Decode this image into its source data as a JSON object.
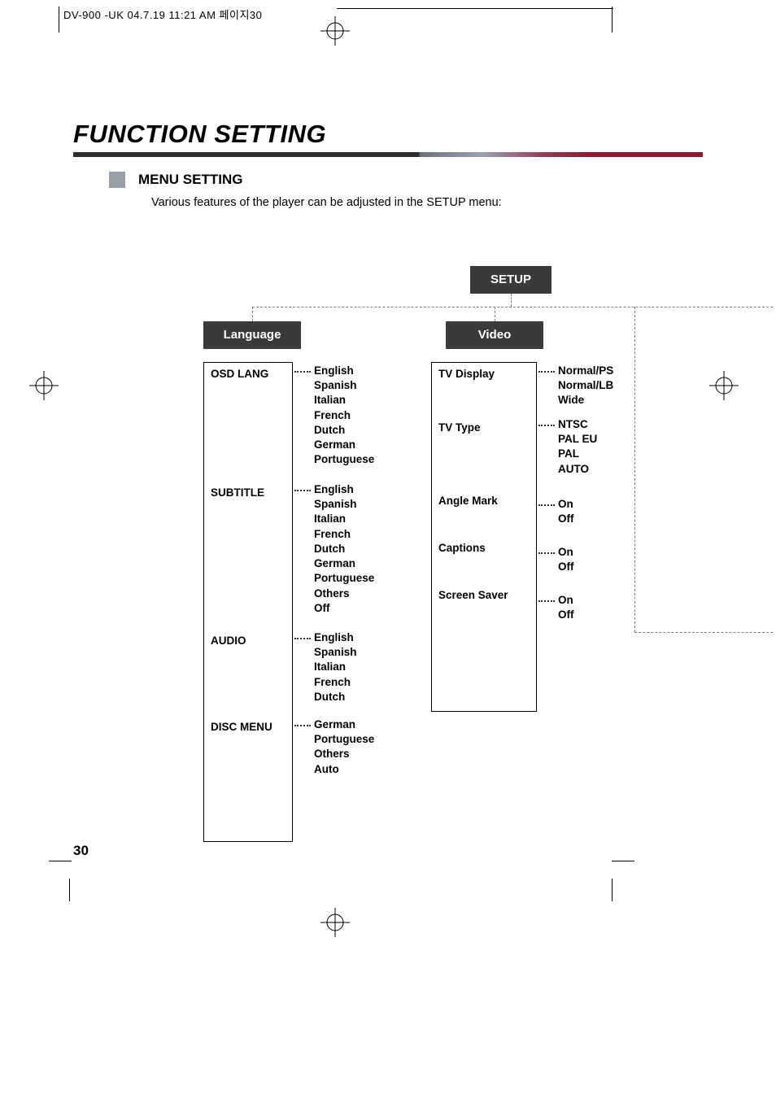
{
  "crop_header": "DV-900 -UK  04.7.19 11:21 AM  페이지30",
  "page_title": "FUNCTION SETTING",
  "menu_section_label": "MENU SETTING",
  "intro_text": "Various features of the player can be adjusted in the SETUP menu:",
  "page_number": "30",
  "setup": {
    "root_label": "SETUP",
    "language": {
      "label": "Language",
      "items": {
        "osd_lang": {
          "label": "OSD LANG",
          "options": [
            "English",
            "Spanish",
            "Italian",
            "French",
            "Dutch",
            "German",
            "Portuguese"
          ]
        },
        "subtitle": {
          "label": "SUBTITLE",
          "options": [
            "English",
            "Spanish",
            "Italian",
            "French",
            "Dutch",
            "German",
            "Portuguese",
            "Others",
            "Off"
          ]
        },
        "audio": {
          "label": "AUDIO",
          "options": [
            "English",
            "Spanish",
            "Italian",
            "French",
            "Dutch"
          ]
        },
        "disc_menu": {
          "label": "DISC MENU",
          "options": [
            "German",
            "Portuguese",
            "Others",
            "Auto"
          ]
        }
      }
    },
    "video": {
      "label": "Video",
      "items": {
        "tv_display": {
          "label": "TV Display",
          "options": [
            "Normal/PS",
            "Normal/LB",
            "Wide"
          ]
        },
        "tv_type": {
          "label": "TV Type",
          "options": [
            "NTSC",
            "PAL EU",
            "PAL",
            "AUTO"
          ]
        },
        "angle_mark": {
          "label": "Angle Mark",
          "options": [
            "On",
            "Off"
          ]
        },
        "captions": {
          "label": "Captions",
          "options": [
            "On",
            "Off"
          ]
        },
        "screen_saver": {
          "label": "Screen Saver",
          "options": [
            "On",
            "Off"
          ]
        }
      }
    }
  }
}
